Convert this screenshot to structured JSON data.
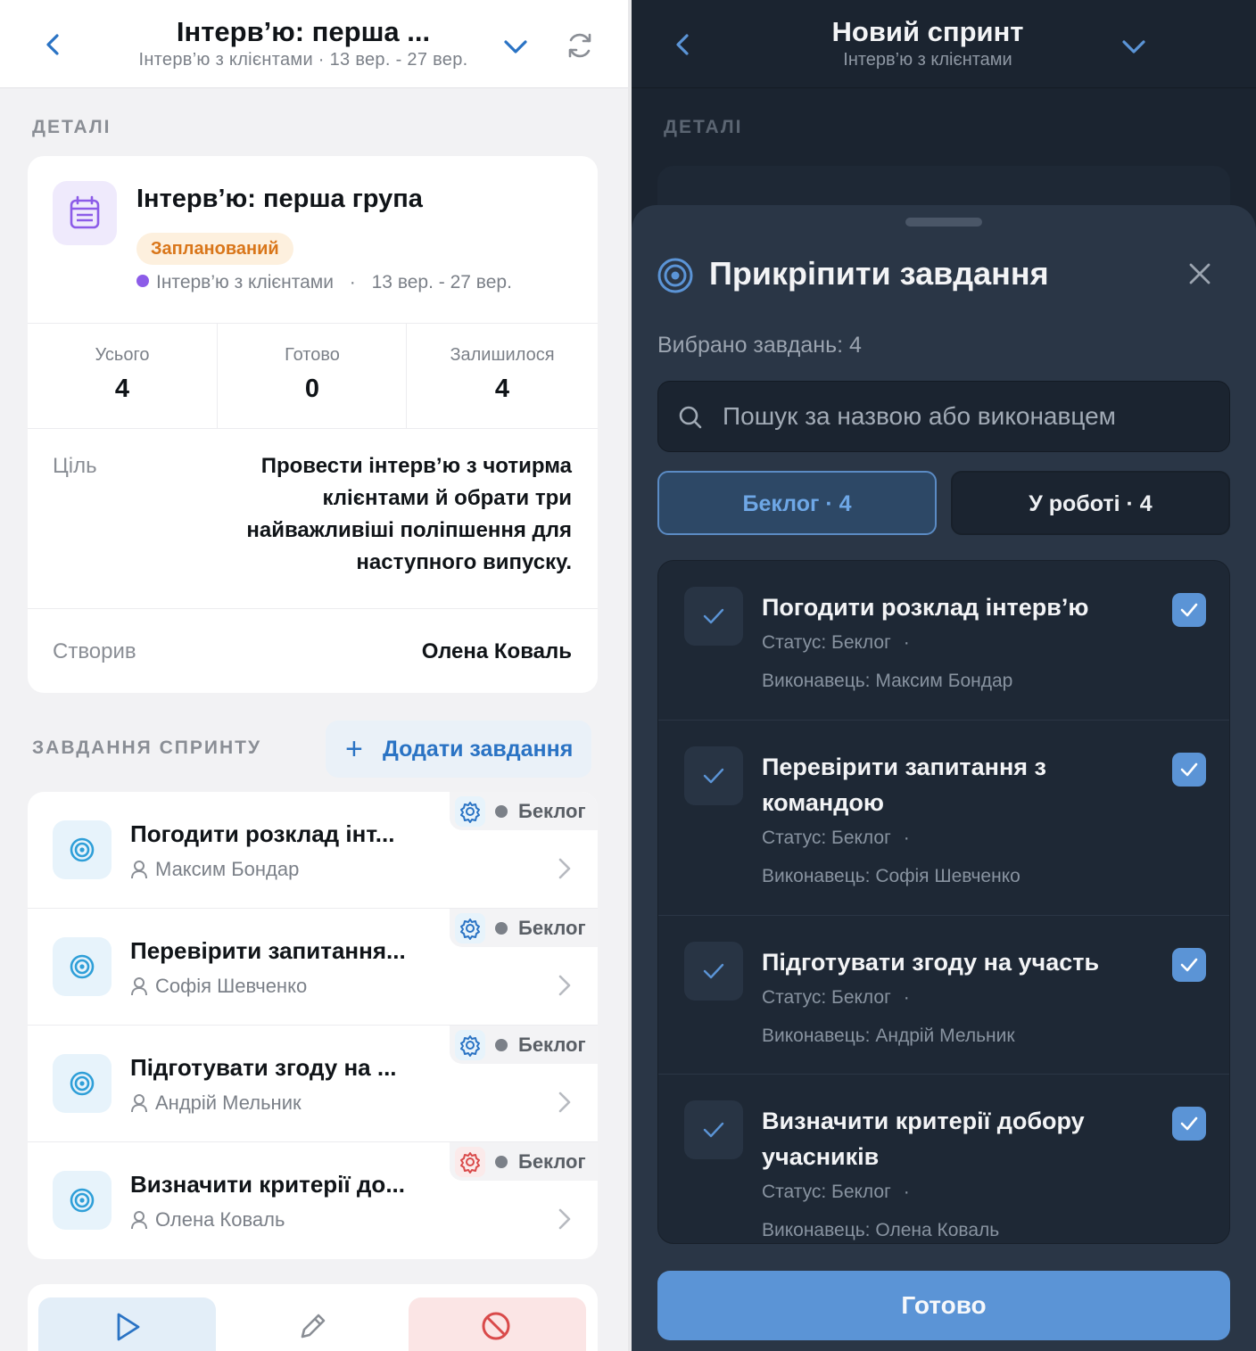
{
  "left": {
    "header": {
      "title": "Інтерв’ю: перша ...",
      "subtitle": "Інтерв’ю з клієнтами · 13 вер. - 27 вер."
    },
    "details_label": "ДЕТАЛІ",
    "sprint": {
      "name": "Інтерв’ю: перша група",
      "status": "Запланований",
      "project": "Інтерв’ю з клієнтами",
      "separator": "·",
      "dates": "13 вер. - 27 вер."
    },
    "stats": [
      {
        "label": "Усього",
        "value": "4"
      },
      {
        "label": "Готово",
        "value": "0"
      },
      {
        "label": "Залишилося",
        "value": "4"
      }
    ],
    "goal": {
      "label": "Ціль",
      "text": "Провести інтерв’ю з чотирма клієнтами й обрати три найважливіші поліпшення для наступного випуску."
    },
    "creator": {
      "label": "Створив",
      "value": "Олена Коваль"
    },
    "tasks_label": "ЗАВДАННЯ СПРИНТУ",
    "add_task": "Додати завдання",
    "tasks": [
      {
        "name": "Погодити розклад інт...",
        "assignee": "Максим Бондар",
        "status": "Беклог"
      },
      {
        "name": "Перевірити запитання...",
        "assignee": "Софія Шевченко",
        "status": "Беклог"
      },
      {
        "name": "Підготувати згоду на ...",
        "assignee": "Андрій Мельник",
        "status": "Беклог"
      },
      {
        "name": "Визначити критерії до...",
        "assignee": "Олена Коваль",
        "status": "Беклог"
      }
    ]
  },
  "right": {
    "header": {
      "title": "Новий спринт",
      "subtitle": "Інтерв’ю з клієнтами"
    },
    "details_label": "ДЕТАЛІ",
    "sheet": {
      "title": "Прикріпити завдання",
      "selected": "Вибрано завдань: 4",
      "search_placeholder": "Пошук за назвою або виконавцем",
      "tabs": [
        {
          "label": "Беклог · 4",
          "active": true
        },
        {
          "label": "У роботі · 4",
          "active": false
        }
      ],
      "items": [
        {
          "name": "Погодити розклад інтерв’ю",
          "status": "Статус: Беклог",
          "dot": "·",
          "assignee": "Виконавець: Максим Бондар",
          "checked": true
        },
        {
          "name": "Перевірити запитання з командою",
          "status": "Статус: Беклог",
          "dot": "·",
          "assignee": "Виконавець: Софія Шевченко",
          "checked": true
        },
        {
          "name": "Підготувати згоду на участь",
          "status": "Статус: Беклог",
          "dot": "·",
          "assignee": "Виконавець: Андрій Мельник",
          "checked": true
        },
        {
          "name": "Визначити критерії добору учасників",
          "status": "Статус: Беклог",
          "dot": "·",
          "assignee": "Виконавець: Олена Коваль",
          "checked": true
        }
      ],
      "done": "Готово"
    }
  },
  "colors": {
    "accent": "#2a73c4",
    "planned": "#d9761a",
    "dark_bg": "#1b2430",
    "sheet_bg": "#2a3646",
    "check": "#5b94d6"
  }
}
